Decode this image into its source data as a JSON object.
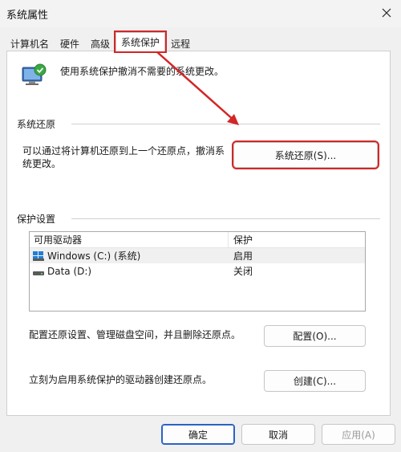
{
  "window": {
    "title": "系统属性"
  },
  "tabs": [
    {
      "label": "计算机名",
      "active": false
    },
    {
      "label": "硬件",
      "active": false
    },
    {
      "label": "高级",
      "active": false
    },
    {
      "label": "系统保护",
      "active": true
    },
    {
      "label": "远程",
      "active": false
    }
  ],
  "intro": {
    "text": "使用系统保护撤消不需要的系统更改。",
    "icon": "system-protection-icon"
  },
  "restore": {
    "group_title": "系统还原",
    "description": "可以通过将计算机还原到上一个还原点，撤消系统更改。",
    "button_label": "系统还原(S)..."
  },
  "protection": {
    "group_title": "保护设置",
    "columns": [
      "可用驱动器",
      "保护"
    ],
    "drives": [
      {
        "name": "Windows (C:) (系统)",
        "status": "启用",
        "icon": "system-drive-icon"
      },
      {
        "name": "Data (D:)",
        "status": "关闭",
        "icon": "drive-icon"
      }
    ],
    "configure_text": "配置还原设置、管理磁盘空间，并且删除还原点。",
    "configure_button": "配置(O)...",
    "create_text": "立刻为启用系统保护的驱动器创建还原点。",
    "create_button": "创建(C)..."
  },
  "footer": {
    "ok": "确定",
    "cancel": "取消",
    "apply": "应用(A)"
  },
  "colors": {
    "highlight": "#d32626",
    "accent": "#2b63c4"
  }
}
